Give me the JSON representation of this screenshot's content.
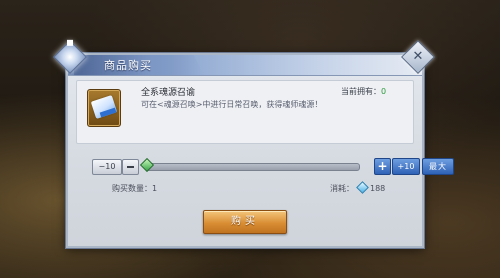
{
  "dialog": {
    "title": "商品购买",
    "close_icon": "close-icon"
  },
  "item": {
    "icon": "scroll-icon",
    "name": "全系魂源召谕",
    "owned_label": "当前拥有：",
    "owned_count": "0",
    "description": "可在<魂源召唤>中进行日常召唤，获得魂师魂源！"
  },
  "quantity": {
    "minus10_label": "−10",
    "minus_icon": "minus-icon",
    "plus_label": "+",
    "plus10_label": "+10",
    "max_label": "最大",
    "slider_fraction": 0.0,
    "count_label": "购买数量：",
    "count_value": "1"
  },
  "cost": {
    "label": "消耗：",
    "currency_icon": "diamond-icon",
    "value": "188"
  },
  "buy_button": {
    "label": "购买"
  },
  "colors": {
    "accent_blue": "#2e62b6",
    "buy_orange": "#d98e34",
    "owned_green": "#2e9a3e",
    "slider_green": "#5dbb5b"
  }
}
